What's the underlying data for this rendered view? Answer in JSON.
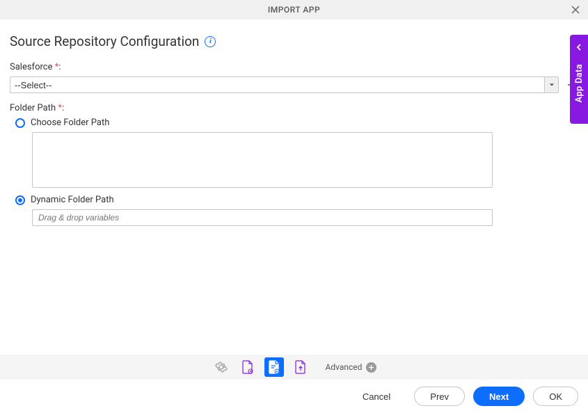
{
  "header": {
    "title": "IMPORT APP"
  },
  "section": {
    "title": "Source Repository Configuration"
  },
  "fields": {
    "salesforce": {
      "label": "Salesforce",
      "select_value": "--Select--"
    },
    "folder_path": {
      "label": "Folder Path",
      "choose_label": "Choose Folder Path",
      "dynamic_label": "Dynamic Folder Path",
      "dynamic_placeholder": "Drag & drop variables"
    }
  },
  "side_tab": {
    "label": "App Data"
  },
  "toolbar": {
    "advanced_label": "Advanced"
  },
  "footer": {
    "cancel_label": "Cancel",
    "prev_label": "Prev",
    "next_label": "Next",
    "ok_label": "OK"
  },
  "colors": {
    "primary": "#0d6efd",
    "purple": "#8719e0",
    "header_bg": "#f0f0f0"
  }
}
